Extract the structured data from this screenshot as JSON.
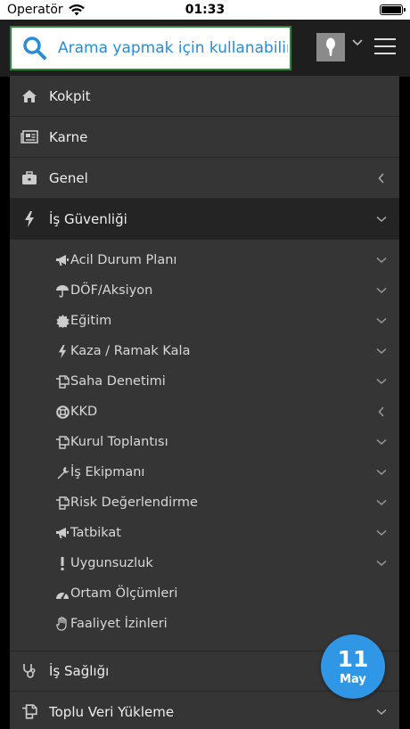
{
  "statusbar": {
    "carrier": "Operatör",
    "time": "01:33"
  },
  "search": {
    "placeholder": "Arama yapmak için kullanabilirsiniz"
  },
  "menu": {
    "items": [
      {
        "label": "Kokpit",
        "icon": "home-icon"
      },
      {
        "label": "Karne",
        "icon": "newspaper-icon"
      },
      {
        "label": "Genel",
        "icon": "briefcase-icon",
        "caret": "left"
      },
      {
        "label": "İş Güvenliği",
        "icon": "bolt-icon",
        "caret": "down",
        "active": true
      }
    ],
    "subitems": [
      {
        "label": "Acil Durum Planı",
        "icon": "bullhorn-icon",
        "caret": "down"
      },
      {
        "label": "DÖF/Aksiyon",
        "icon": "umbrella-icon",
        "caret": "down"
      },
      {
        "label": "Eğitim",
        "icon": "certificate-icon",
        "caret": "down"
      },
      {
        "label": "Kaza / Ramak Kala",
        "icon": "bolt-icon",
        "caret": "down"
      },
      {
        "label": "Saha Denetimi",
        "icon": "copy-icon",
        "caret": "down"
      },
      {
        "label": "KKD",
        "icon": "life-ring-icon",
        "caret": "left"
      },
      {
        "label": "Kurul Toplantısı",
        "icon": "copy-icon",
        "caret": "down"
      },
      {
        "label": "İş Ekipmanı",
        "icon": "wrench-icon",
        "caret": "down"
      },
      {
        "label": "Risk Değerlendirme",
        "icon": "copy-icon",
        "caret": "down"
      },
      {
        "label": "Tatbikat",
        "icon": "bullhorn-icon",
        "caret": "down"
      },
      {
        "label": "Uygunsuzluk",
        "icon": "exclamation-icon",
        "caret": "down"
      },
      {
        "label": "Ortam Ölçümleri",
        "icon": "dashboard-icon"
      },
      {
        "label": "Faaliyet İzinleri",
        "icon": "hand-icon"
      }
    ],
    "bottom_items": [
      {
        "label": "İş Sağlığı",
        "icon": "stethoscope-icon"
      },
      {
        "label": "Toplu Veri Yükleme",
        "icon": "copy-icon",
        "caret": "down"
      }
    ]
  },
  "date_badge": {
    "day": "11",
    "month": "May"
  },
  "colors": {
    "accent": "#2f97e6",
    "search_border": "#2b8a3e",
    "menu_bg": "#353535",
    "header_bg": "#1e1e1e"
  }
}
